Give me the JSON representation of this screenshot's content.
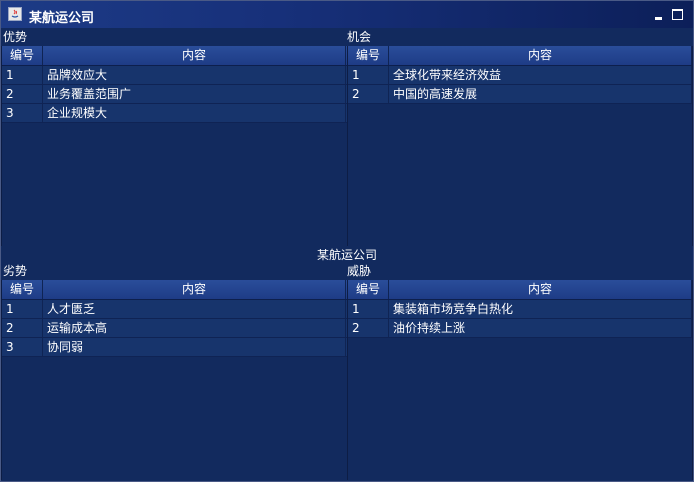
{
  "window": {
    "title": "某航运公司",
    "center_label": "某航运公司"
  },
  "columns": {
    "id": "编号",
    "content": "内容"
  },
  "quadrants": {
    "strengths": {
      "label": "优势",
      "rows": [
        {
          "id": "1",
          "content": "品牌效应大"
        },
        {
          "id": "2",
          "content": "业务覆盖范围广"
        },
        {
          "id": "3",
          "content": "企业规模大"
        }
      ]
    },
    "opportunities": {
      "label": "机会",
      "rows": [
        {
          "id": "1",
          "content": "全球化带来经济效益"
        },
        {
          "id": "2",
          "content": "中国的高速发展"
        }
      ]
    },
    "weaknesses": {
      "label": "劣势",
      "rows": [
        {
          "id": "1",
          "content": "人才匮乏"
        },
        {
          "id": "2",
          "content": "运输成本高"
        },
        {
          "id": "3",
          "content": "协同弱"
        }
      ]
    },
    "threats": {
      "label": "威胁",
      "rows": [
        {
          "id": "1",
          "content": "集装箱市场竞争白热化"
        },
        {
          "id": "2",
          "content": "油价持续上涨"
        }
      ]
    }
  }
}
